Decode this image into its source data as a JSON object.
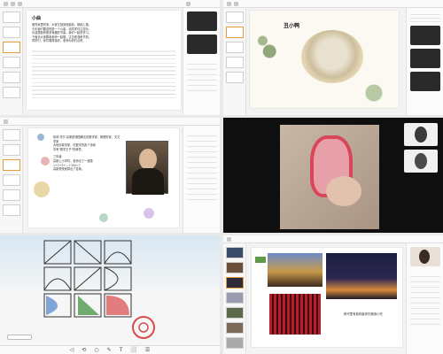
{
  "panels": {
    "p1": {
      "slide_title": "小曲",
      "lines": [
        "做完家里的事，大家又回到电脑前，继续上课。",
        "今天我们要讲的是一个小曲，请同学们注意听。",
        "乐曲里面有很多有趣的节奏，我们一起来学习。",
        "下面请大家跟着老师一起唱，注意音准和节拍。",
        "同学们，你们唱得真好，老师为你们点赞。"
      ]
    },
    "p2": {
      "slide_title": "丑小鸭"
    },
    "p3": {
      "body": [
        "哈利·托尔·高斯是德国著名的数学家，物理学家，天文学家",
        "大地测量学家，在数学的各个领域",
        "享有\"数学王子\"的美誉。",
        "三年级",
        "高斯上小学时，老师出了一道题",
        "1+2+3+…+100=?",
        "高斯很快就算出了答案。"
      ]
    },
    "p5": {
      "toolbar": [
        "◁",
        "⟲",
        "○",
        "✎",
        "T",
        "⬜",
        "☰"
      ]
    },
    "p6": {
      "caption": "夜市里有各种各样的美食小吃"
    }
  }
}
